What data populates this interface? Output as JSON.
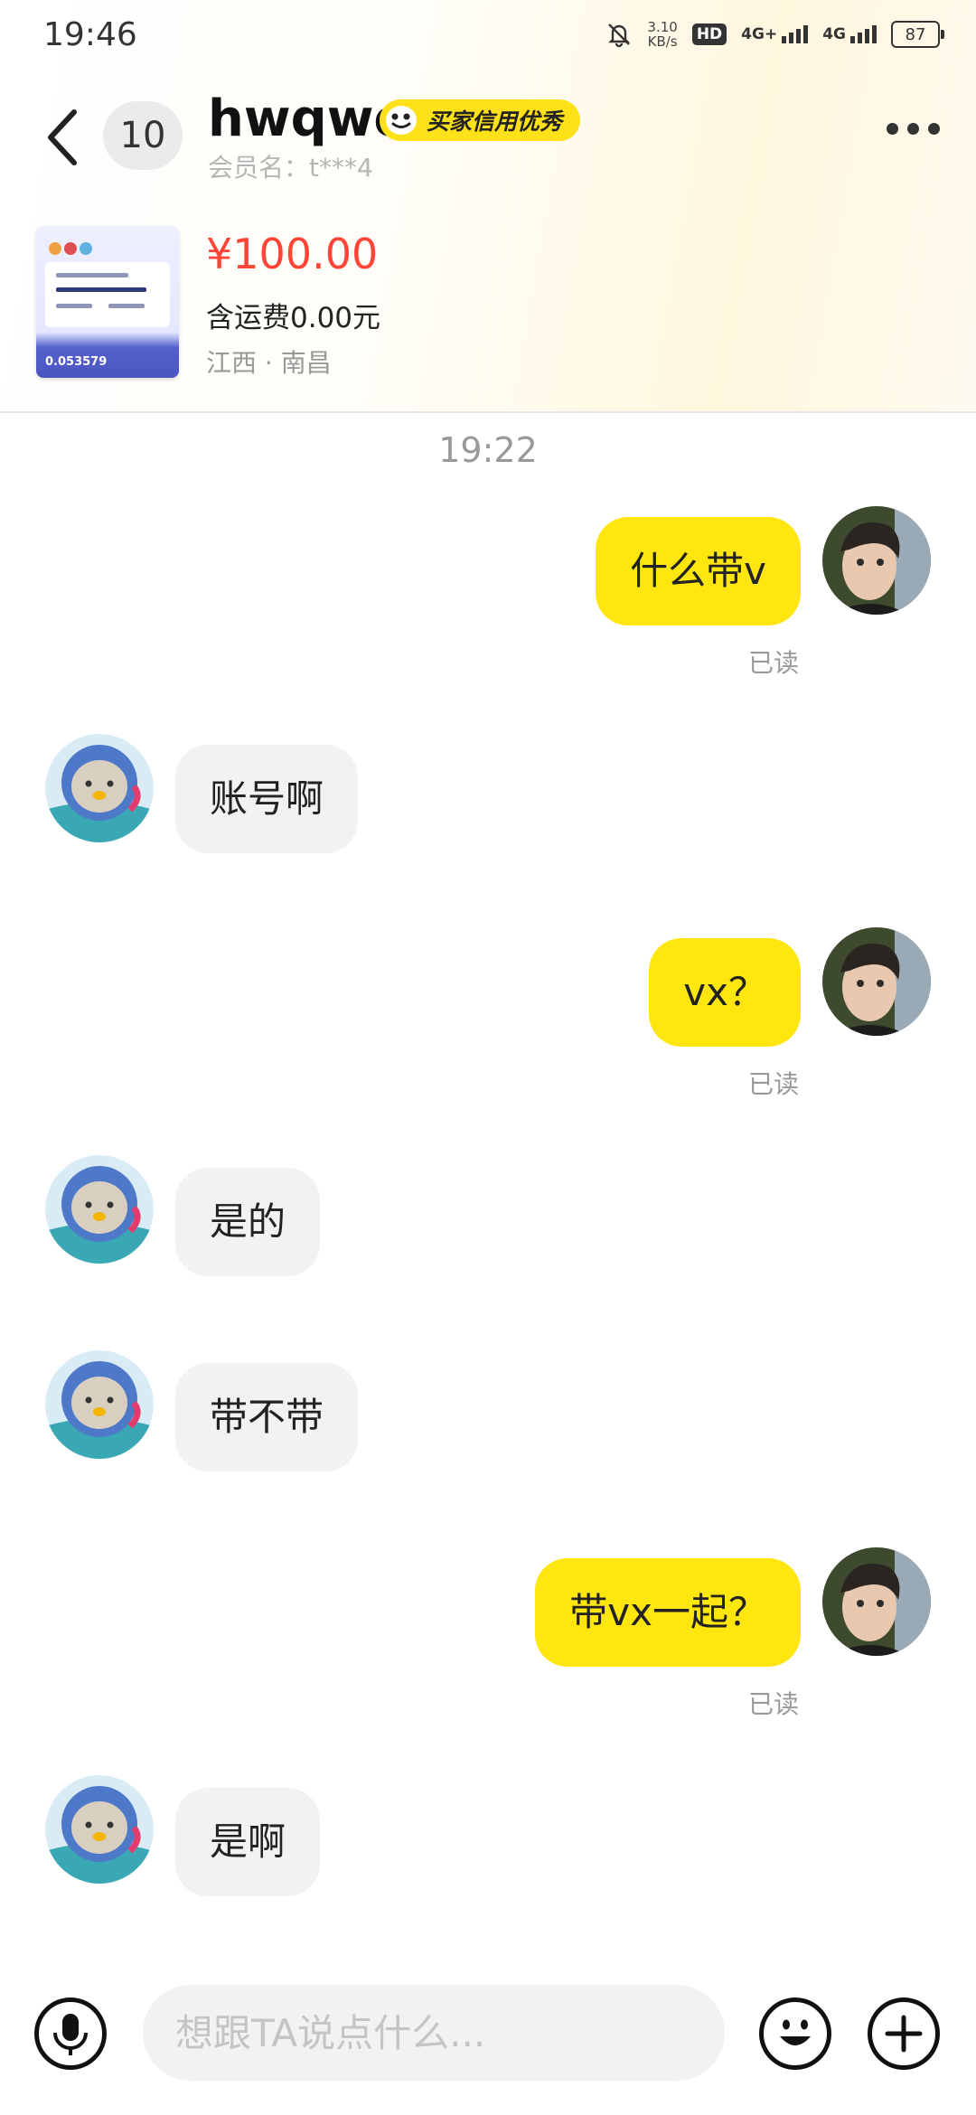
{
  "status_bar": {
    "time": "19:46",
    "net_speed_value": "3.10",
    "net_speed_unit": "KB/s",
    "hd_label": "HD",
    "sim1_label": "4G+",
    "sim2_label": "4G",
    "battery": "87"
  },
  "header": {
    "unread_count": "10",
    "seller_name": "hwqwe",
    "credit_badge": "买家信用优秀",
    "member_name": "会员名：t***4"
  },
  "product": {
    "price": "¥100.00",
    "shipping": "含运费0.00元",
    "location": "江西 · 南昌",
    "thumb_balance": "0.053579"
  },
  "chat": {
    "time_label": "19:22",
    "read_label": "已读",
    "messages": [
      {
        "sender": "me",
        "text": "什么带v",
        "status": "已读"
      },
      {
        "sender": "them",
        "text": "账号啊"
      },
      {
        "sender": "me",
        "text": "vx？",
        "status": "已读"
      },
      {
        "sender": "them",
        "text": "是的"
      },
      {
        "sender": "them",
        "text": "带不带"
      },
      {
        "sender": "me",
        "text": "带vx一起？",
        "status": "已读"
      },
      {
        "sender": "them",
        "text": "是啊"
      }
    ]
  },
  "input": {
    "placeholder": "想跟TA说点什么..."
  },
  "colors": {
    "accent_yellow": "#ffe60f",
    "price_red": "#ff4538",
    "bubble_gray": "#f2f2f4"
  },
  "icons": [
    "back-arrow-icon",
    "more-icon",
    "microphone-icon",
    "emoji-icon",
    "plus-icon",
    "mute-bell-icon"
  ]
}
